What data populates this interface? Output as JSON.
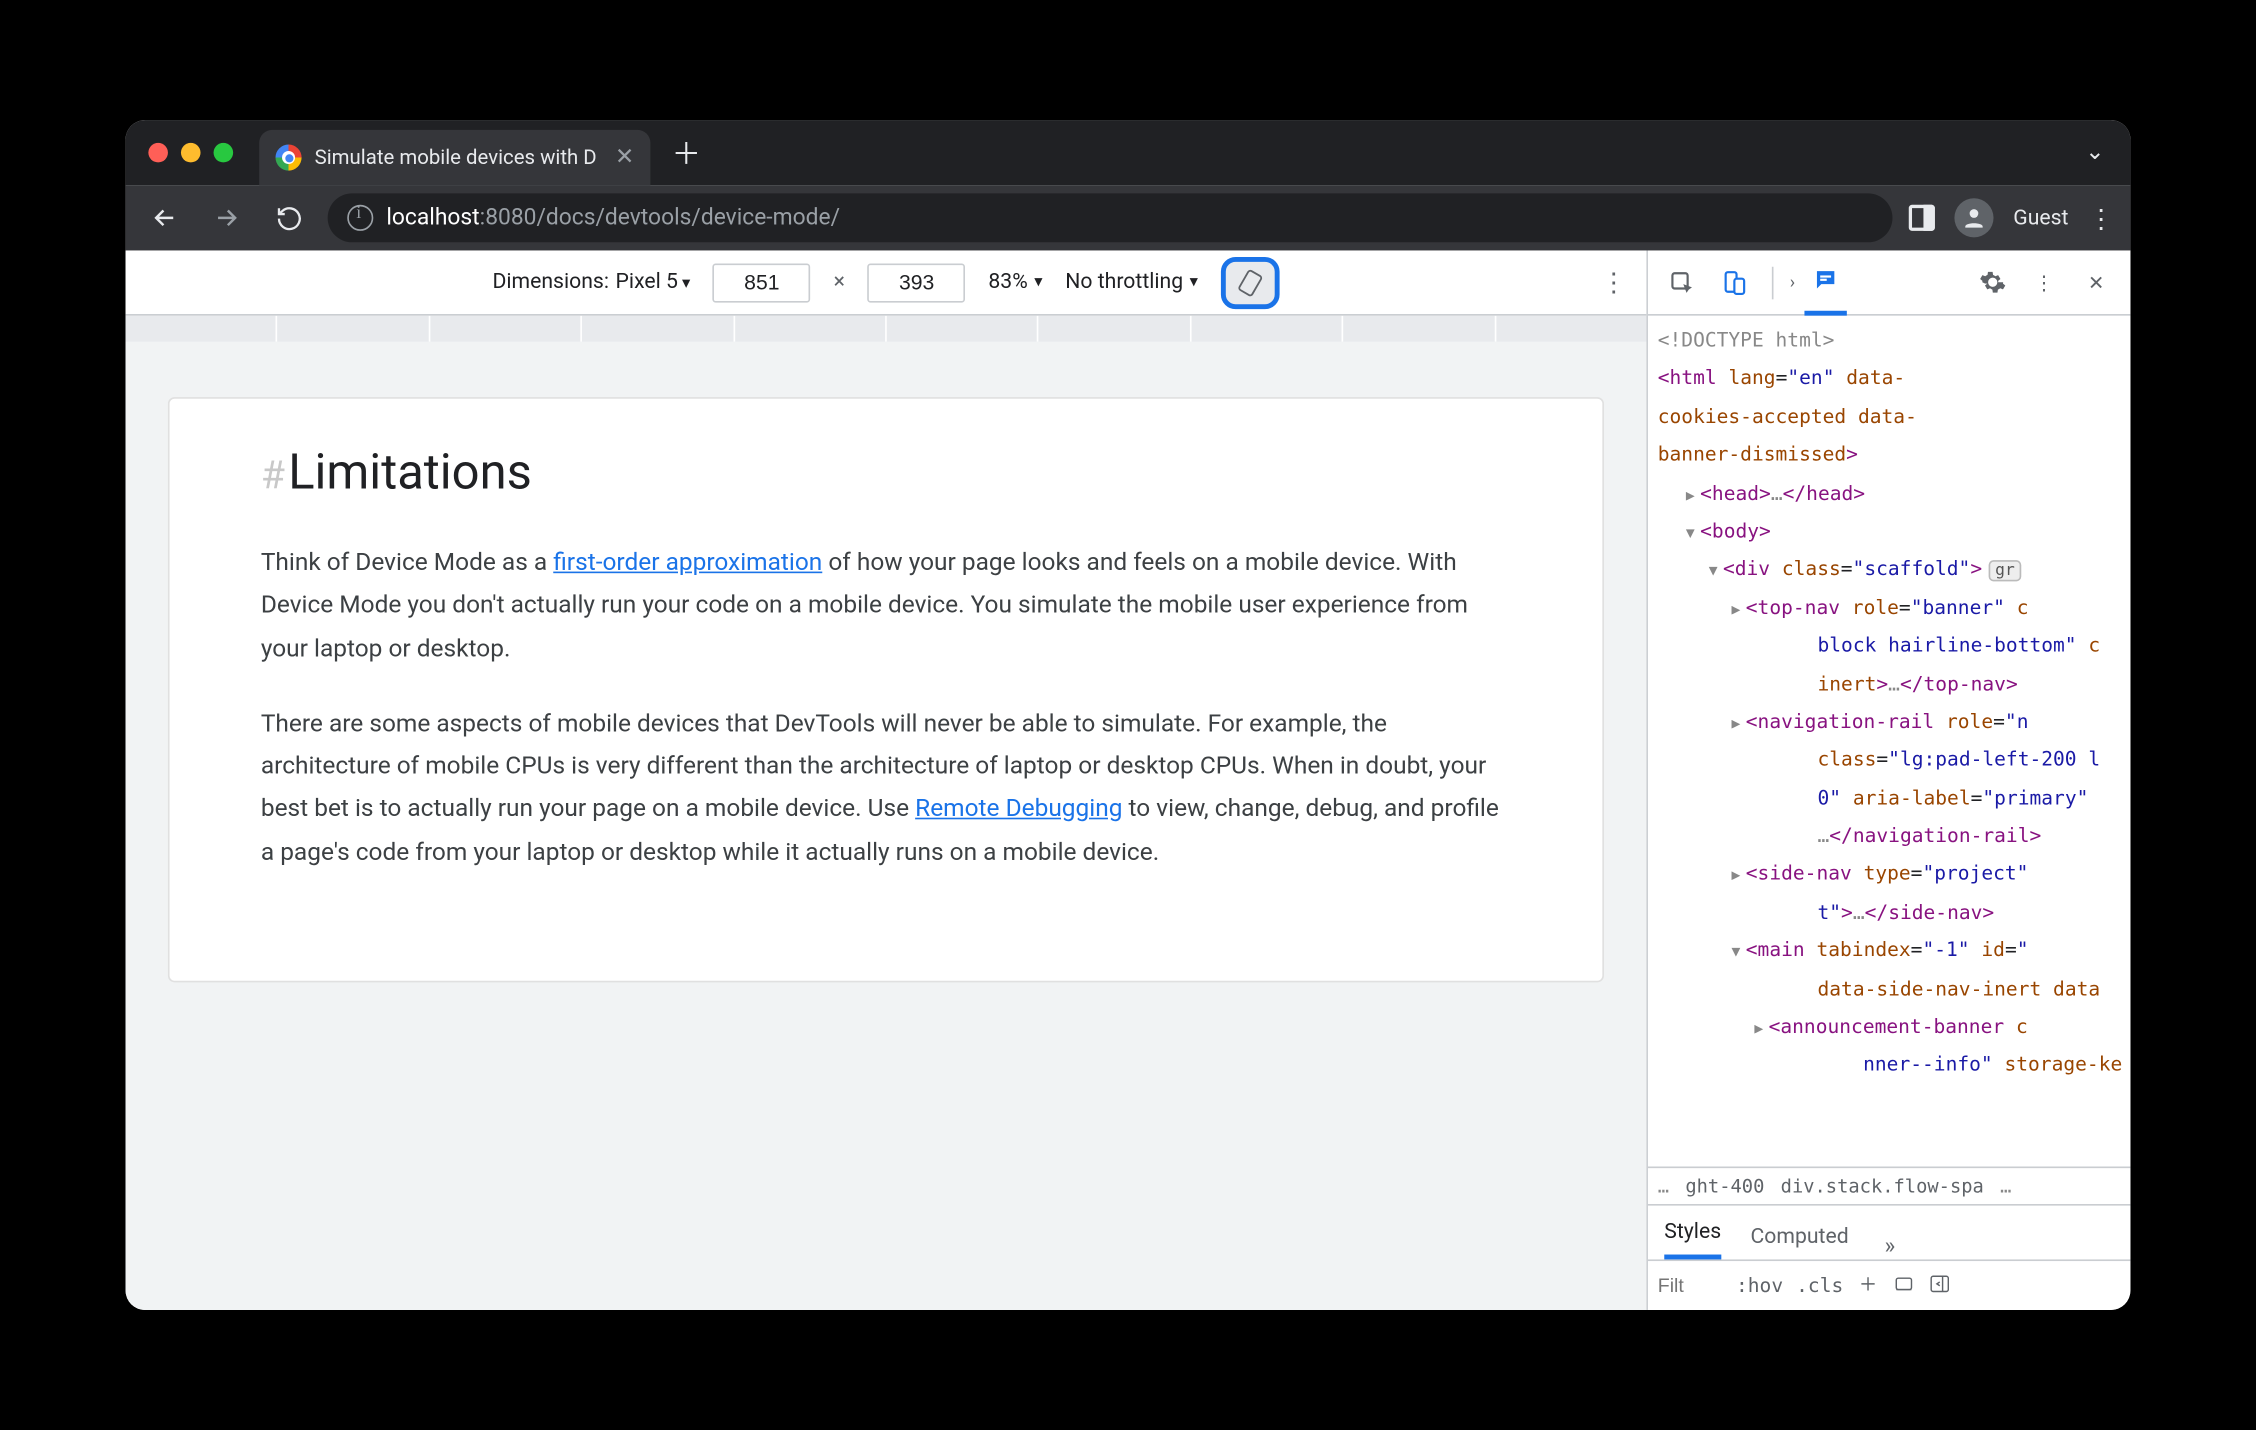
{
  "tab": {
    "title": "Simulate mobile devices with D"
  },
  "addressbar": {
    "host": "localhost",
    "rest": ":8080/docs/devtools/device-mode/",
    "guest": "Guest"
  },
  "device_toolbar": {
    "dimensions_prefix": "Dimensions:",
    "device": "Pixel 5",
    "width": "851",
    "height": "393",
    "x": "×",
    "zoom": "83%",
    "throttle": "No throttling"
  },
  "page": {
    "heading": "Limitations",
    "hash": "#",
    "p1_a": "Think of Device Mode as a ",
    "p1_link": "first-order approximation",
    "p1_b": " of how your page looks and feels on a mobile device. With Device Mode you don't actually run your code on a mobile device. You simulate the mobile user experience from your laptop or desktop.",
    "p2_a": "There are some aspects of mobile devices that DevTools will never be able to simulate. For example, the architecture of mobile CPUs is very different than the architecture of laptop or desktop CPUs. When in doubt, your best bet is to actually run your page on a mobile device. Use ",
    "p2_link": "Remote Debugging",
    "p2_b": " to view, change, debug, and profile a page's code from your laptop or desktop while it actually runs on a mobile device."
  },
  "elements": {
    "doctype": "<!DOCTYPE html>",
    "html_open": "<html lang=\"en\" data-cookies-accepted data-banner-dismissed>",
    "head": "<head>…</head>",
    "body": "<body>",
    "div_scaffold_a": "<div class=\"scaffold\">",
    "grid_badge": "gr",
    "topnav": "<top-nav role=\"banner\" c block hairline-bottom\" c inert>…</top-nav>",
    "navrail": "<navigation-rail role=\"n class=\"lg:pad-left-200 l 0\" aria-label=\"primary\" …</navigation-rail>",
    "sidenav": "<side-nav type=\"project\" t\">…</side-nav>",
    "main": "<main tabindex=\"-1\" id=\" data-side-nav-inert data",
    "announce": "<announcement-banner c nner--info\" storage-ke"
  },
  "breadcrumb": {
    "dots1": "…",
    "a": "ght-400",
    "b": "div.stack.flow-spa",
    "dots2": "…"
  },
  "styles": {
    "tab_styles": "Styles",
    "tab_computed": "Computed",
    "more": "»",
    "filter": "Filt",
    "hov": ":hov",
    "cls": ".cls"
  }
}
